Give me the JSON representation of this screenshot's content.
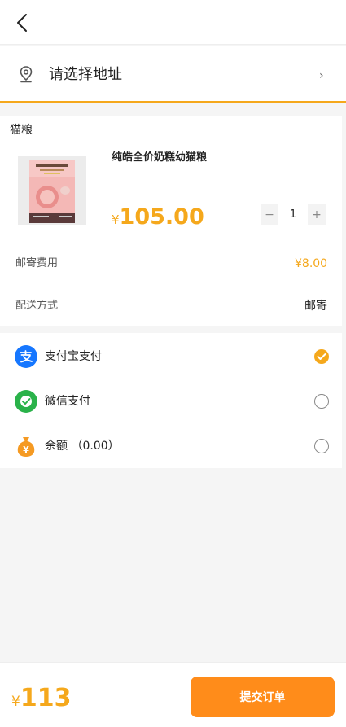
{
  "header": {
    "back_icon": "chevron-left-icon"
  },
  "address": {
    "placeholder": "请选择地址",
    "icon": "location-pin-icon",
    "chevron": "›"
  },
  "order": {
    "shop_name": "猫粮",
    "product": {
      "name": "纯皓全价奶糕幼猫粮",
      "currency": "¥",
      "price": "105.00",
      "quantity": "1",
      "minus": "−",
      "plus": "+"
    },
    "shipping": {
      "label": "邮寄费用",
      "value": "¥8.00"
    },
    "delivery": {
      "label": "配送方式",
      "value": "邮寄"
    }
  },
  "payment": {
    "methods": [
      {
        "label": "支付宝支付",
        "icon": "alipay-icon",
        "selected": true
      },
      {
        "label": "微信支付",
        "icon": "wechat-pay-icon",
        "selected": false
      },
      {
        "label": "余额 （0.00）",
        "icon": "balance-money-bag-icon",
        "selected": false
      }
    ]
  },
  "footer": {
    "currency": "¥",
    "total": "113",
    "submit_label": "提交订单"
  },
  "colors": {
    "accent": "#f5a81c",
    "button": "#ff8c1a",
    "alipay": "#1677ff",
    "wechat": "#2ab24a",
    "balance": "#f59a23"
  }
}
